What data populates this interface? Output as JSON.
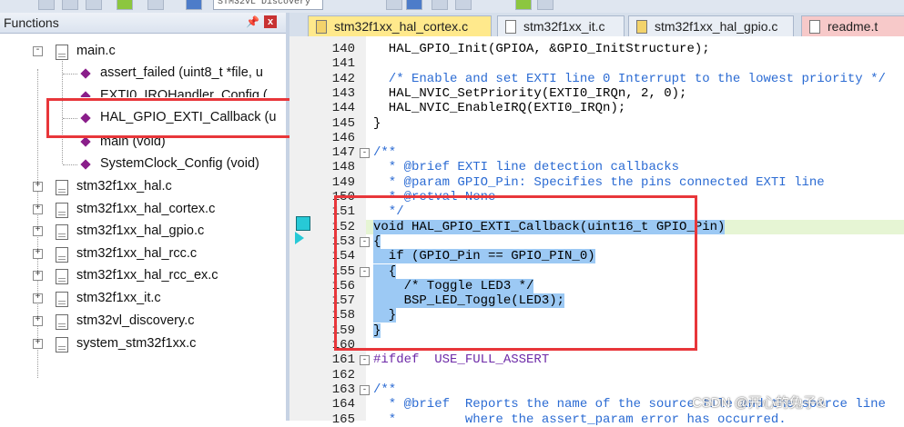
{
  "toolbar": {
    "combo_text": "STM32VL Discovery"
  },
  "panel": {
    "title": "Functions",
    "pin_glyph": "ᵃ",
    "close_glyph": "x",
    "tree": [
      {
        "label": "main.c",
        "kind": "file",
        "expander": "-"
      },
      {
        "label": "assert_failed (uint8_t *file, u",
        "kind": "function"
      },
      {
        "label": "EXTI0_IRQHandler_Config (",
        "kind": "function"
      },
      {
        "label": "HAL_GPIO_EXTI_Callback (u",
        "kind": "function"
      },
      {
        "label": "main (void)",
        "kind": "function"
      },
      {
        "label": "SystemClock_Config (void)",
        "kind": "function"
      },
      {
        "label": "stm32f1xx_hal.c",
        "kind": "file",
        "expander": "+"
      },
      {
        "label": "stm32f1xx_hal_cortex.c",
        "kind": "file",
        "expander": "+"
      },
      {
        "label": "stm32f1xx_hal_gpio.c",
        "kind": "file",
        "expander": "+"
      },
      {
        "label": "stm32f1xx_hal_rcc.c",
        "kind": "file",
        "expander": "+"
      },
      {
        "label": "stm32f1xx_hal_rcc_ex.c",
        "kind": "file",
        "expander": "+"
      },
      {
        "label": "stm32f1xx_it.c",
        "kind": "file",
        "expander": "+"
      },
      {
        "label": "stm32vl_discovery.c",
        "kind": "file",
        "expander": "+"
      },
      {
        "label": "system_stm32f1xx.c",
        "kind": "file",
        "expander": "+"
      }
    ]
  },
  "tabs": [
    {
      "label": "stm32f1xx_hal_cortex.c",
      "state": "active",
      "icon": "key-file-icon"
    },
    {
      "label": "stm32f1xx_it.c",
      "state": "normal",
      "icon": "file-icon"
    },
    {
      "label": "stm32f1xx_hal_gpio.c",
      "state": "normal",
      "icon": "key-file-icon"
    },
    {
      "label": "readme.t",
      "state": "normal",
      "icon": "file-icon"
    }
  ],
  "editor": {
    "lines": [
      {
        "n": "140",
        "code": "  HAL_GPIO_Init(GPIOA, &GPIO_InitStructure);",
        "style": "plain"
      },
      {
        "n": "141",
        "code": "",
        "style": "plain"
      },
      {
        "n": "142",
        "code": "  /* Enable and set EXTI line 0 Interrupt to the lowest priority */",
        "style": "comment"
      },
      {
        "n": "143",
        "code": "  HAL_NVIC_SetPriority(EXTI0_IRQn, 2, 0);",
        "style": "plain"
      },
      {
        "n": "144",
        "code": "  HAL_NVIC_EnableIRQ(EXTI0_IRQn);",
        "style": "plain"
      },
      {
        "n": "145",
        "code": "}",
        "style": "plain"
      },
      {
        "n": "146",
        "code": "",
        "style": "plain"
      },
      {
        "n": "147",
        "code": "/**",
        "style": "comment",
        "fold": "-"
      },
      {
        "n": "148",
        "code": "  * @brief EXTI line detection callbacks",
        "style": "comment"
      },
      {
        "n": "149",
        "code": "  * @param GPIO_Pin: Specifies the pins connected EXTI line",
        "style": "comment"
      },
      {
        "n": "150",
        "code": "  * @retval None",
        "style": "comment"
      },
      {
        "n": "151",
        "code": "  */",
        "style": "comment"
      },
      {
        "n": "152",
        "code": "void HAL_GPIO_EXTI_Callback(uint16_t GPIO_Pin)",
        "style": "sel",
        "highlight": true
      },
      {
        "n": "153",
        "code": "{",
        "style": "sel",
        "fold": "-"
      },
      {
        "n": "154",
        "code": "  if (GPIO_Pin == GPIO_PIN_0)",
        "style": "sel"
      },
      {
        "n": "155",
        "code": "  {",
        "style": "sel",
        "fold": "-"
      },
      {
        "n": "156",
        "code": "    /* Toggle LED3 */",
        "style": "sel"
      },
      {
        "n": "157",
        "code": "    BSP_LED_Toggle(LED3);",
        "style": "sel"
      },
      {
        "n": "158",
        "code": "  }",
        "style": "sel"
      },
      {
        "n": "159",
        "code": "}",
        "style": "sel"
      },
      {
        "n": "160",
        "code": "",
        "style": "plain"
      },
      {
        "n": "161",
        "code": "#ifdef  USE_FULL_ASSERT",
        "style": "pp",
        "fold": "-"
      },
      {
        "n": "162",
        "code": "",
        "style": "plain"
      },
      {
        "n": "163",
        "code": "/**",
        "style": "comment",
        "fold": "-"
      },
      {
        "n": "164",
        "code": "  * @brief  Reports the name of the source file and the source line",
        "style": "comment"
      },
      {
        "n": "165",
        "code": "  *         where the assert_param error has occurred.",
        "style": "comment"
      }
    ]
  },
  "watermark": "CSDN @开心的兔子&",
  "colors": {
    "highlight_box": "#e8363a",
    "selection": "#9cc9f4",
    "active_tab": "#ffe98c"
  }
}
